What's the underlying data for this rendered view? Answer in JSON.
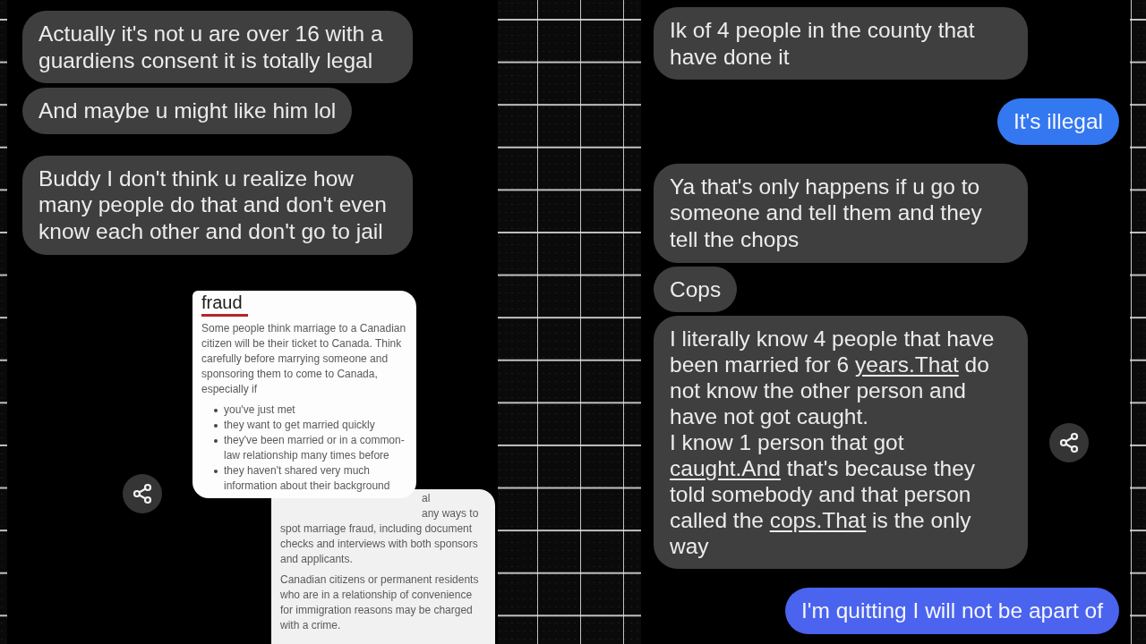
{
  "left_panel": {
    "messages": [
      {
        "kind": "received",
        "text": "Actually it's not u are over 16 with a guardiens consent it is totally legal"
      },
      {
        "kind": "received",
        "text": "And maybe u might like him lol"
      },
      {
        "kind": "received",
        "text": "Buddy I don't think u realize how many people do that and don't even know each other and don't go to jail"
      }
    ],
    "attachment": {
      "cards": [
        {
          "kind": "article",
          "heading": "fraud",
          "paragraphs": [
            "Some people think marriage to a Canadian citizen will be their ticket to Canada. Think carefully before marrying someone and sponsoring them to come to Canada, especially if"
          ],
          "bullets": [
            "you've just met",
            "they want to get married quickly",
            "they've been married or in a common-law relationship many times before",
            "they haven't shared very much information about their background"
          ]
        },
        {
          "kind": "continued",
          "partial_lines": [
            "al",
            "any ways to"
          ],
          "paragraphs": [
            "spot marriage fraud, including document checks and interviews with both sponsors and applicants.",
            "Canadian citizens or permanent residents who are in a relationship of convenience for immigration reasons may be charged with a crime."
          ]
        }
      ]
    }
  },
  "right_panel": {
    "messages": [
      {
        "kind": "received",
        "share_button": false,
        "text": "Ik of 4 people in the county that have done it"
      },
      {
        "kind": "sent",
        "share_button": false,
        "text": "It's illegal"
      },
      {
        "kind": "received",
        "share_button": false,
        "text": "Ya that's only happens if u go to someone and tell them and they tell the chops"
      },
      {
        "kind": "received",
        "share_button": false,
        "text": "Cops"
      },
      {
        "kind": "received",
        "share_button": true,
        "paragraphs": [
          [
            {
              "kind": "text",
              "text": "I literally know 4 people that have been married for 6 "
            },
            {
              "kind": "link",
              "text": "years.That"
            },
            {
              "kind": "text",
              "text": " do not know the other person and have not got caught."
            }
          ],
          [
            {
              "kind": "text",
              "text": "I know 1 person that got "
            },
            {
              "kind": "link",
              "text": "caught.And"
            },
            {
              "kind": "text",
              "text": " that's because they told somebody and that person called the "
            },
            {
              "kind": "link",
              "text": "cops.That"
            },
            {
              "kind": "text",
              "text": " is the only way"
            }
          ]
        ]
      },
      {
        "kind": "sent",
        "share_button": false,
        "text": "I'm quitting I will not be apart of"
      }
    ]
  }
}
